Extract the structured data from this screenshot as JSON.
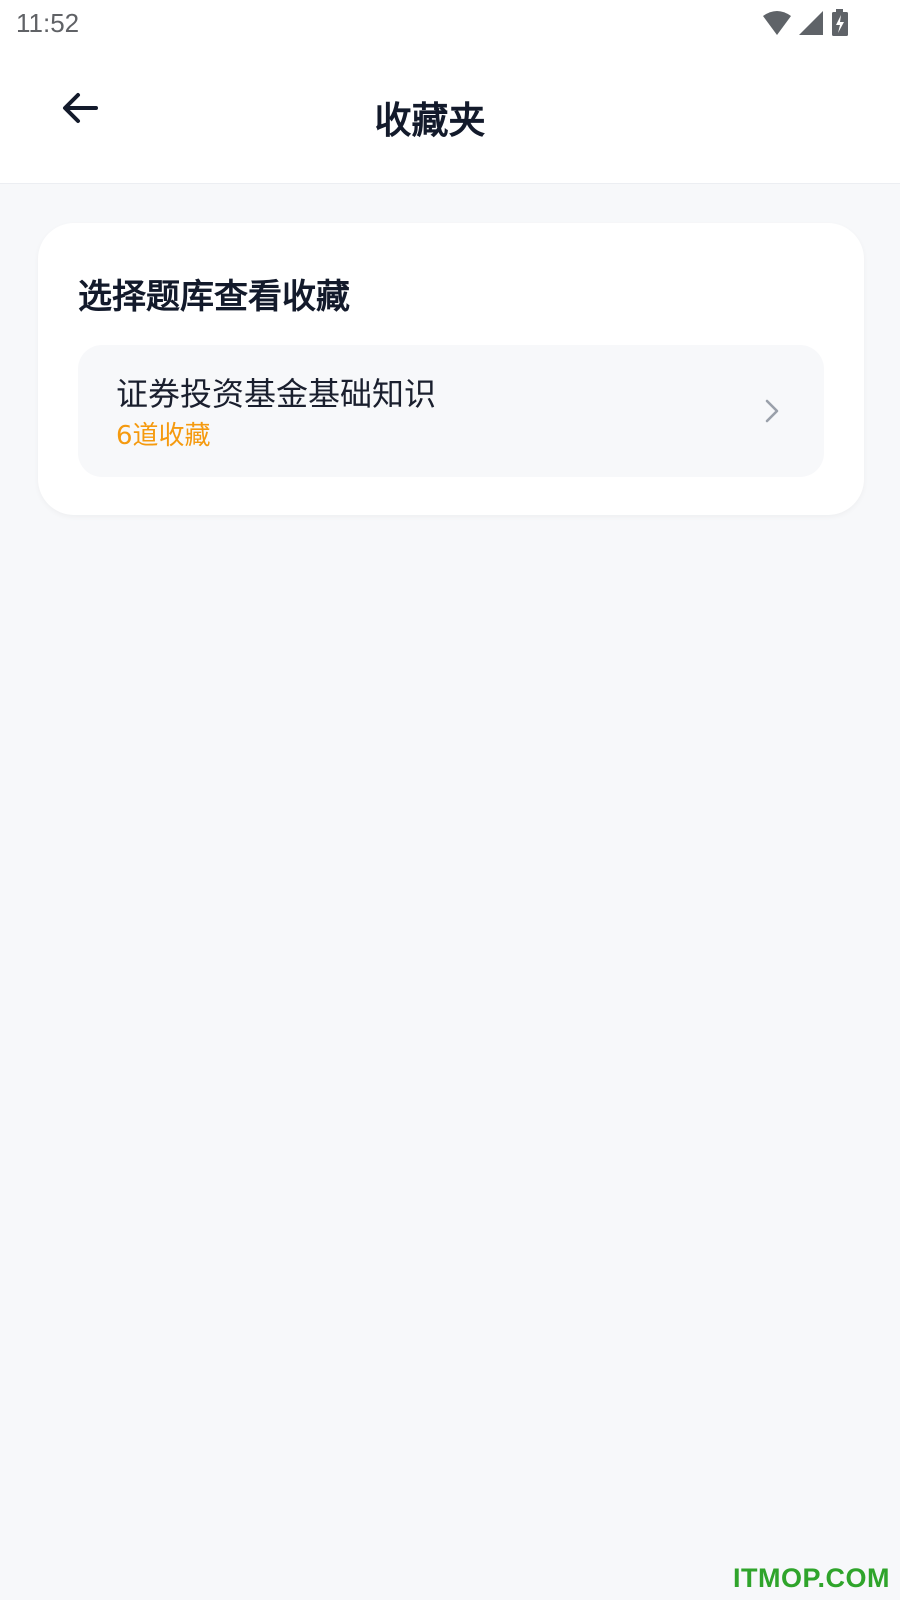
{
  "status_bar": {
    "time": "11:52",
    "icons": [
      "wifi-icon",
      "signal-icon",
      "battery-charging-icon"
    ]
  },
  "header": {
    "title": "收藏夹",
    "back_icon": "arrow-left-icon"
  },
  "card": {
    "title": "选择题库查看收藏",
    "items": [
      {
        "name": "证券投资基金基础知识",
        "count_label": "6道收藏",
        "icon": "chevron-right-icon"
      }
    ]
  },
  "watermark": "ITMOP.COM",
  "colors": {
    "background": "#f7f8fa",
    "title_text": "#131a2b",
    "accent_orange": "#f59a0f",
    "watermark_green": "#2fa42b"
  }
}
